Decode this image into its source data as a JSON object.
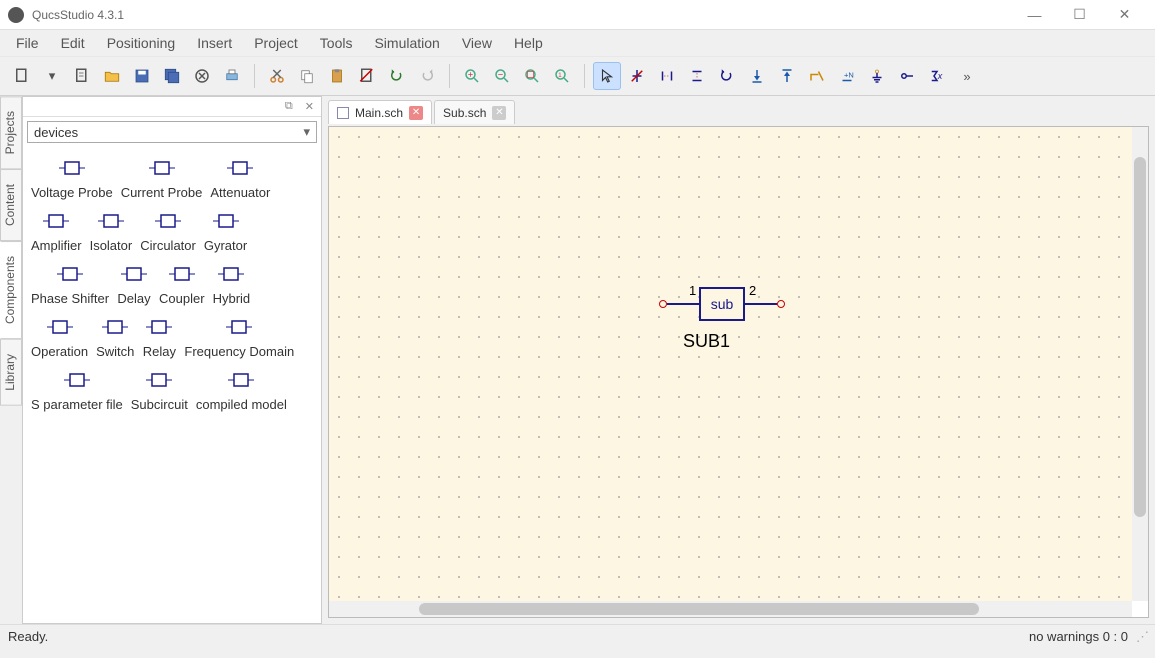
{
  "app_title": "QucsStudio 4.3.1",
  "menu": [
    "File",
    "Edit",
    "Positioning",
    "Insert",
    "Project",
    "Tools",
    "Simulation",
    "View",
    "Help"
  ],
  "side_tabs": [
    "Projects",
    "Content",
    "Components",
    "Library"
  ],
  "components_combo": "devices",
  "components": [
    {
      "label": "Voltage Probe"
    },
    {
      "label": "Current Probe"
    },
    {
      "label": "Attenuator"
    },
    {
      "label": "Amplifier"
    },
    {
      "label": "Isolator"
    },
    {
      "label": "Circulator"
    },
    {
      "label": "Gyrator"
    },
    {
      "label": "Phase Shifter"
    },
    {
      "label": "Delay"
    },
    {
      "label": "Coupler"
    },
    {
      "label": "Hybrid"
    },
    {
      "label": "Operation"
    },
    {
      "label": "Switch"
    },
    {
      "label": "Relay"
    },
    {
      "label": "Frequency Domain"
    },
    {
      "label": "S parameter file"
    },
    {
      "label": "Subcircuit"
    },
    {
      "label": "compiled model"
    }
  ],
  "doc_tabs": [
    {
      "label": "Main.sch",
      "active": true
    },
    {
      "label": "Sub.sch",
      "active": false
    }
  ],
  "schematic": {
    "block_text": "sub",
    "port_left": "1",
    "port_right": "2",
    "name": "SUB1"
  },
  "status_left": "Ready.",
  "status_right": "no warnings  0 : 0"
}
